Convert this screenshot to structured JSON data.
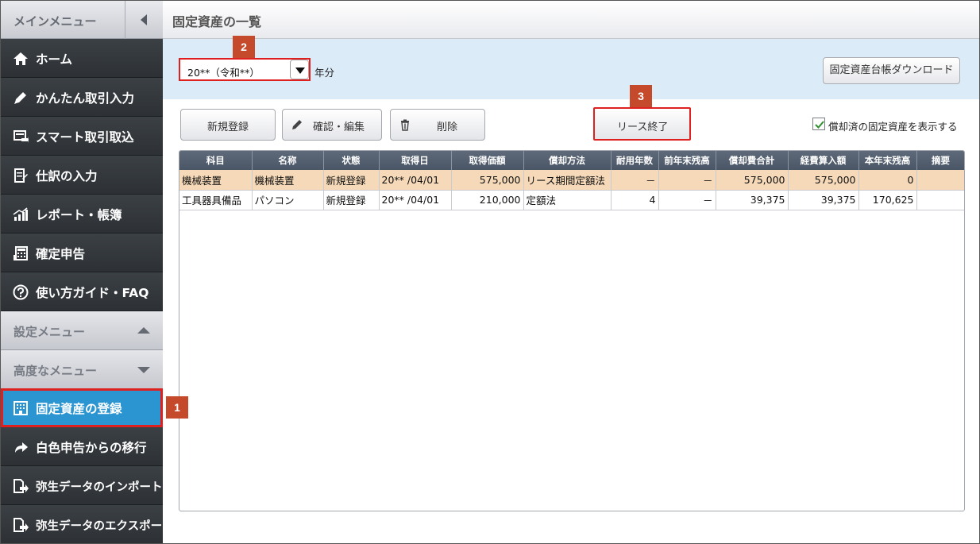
{
  "sidebar": {
    "main_menu_label": "メインメニュー",
    "items": [
      {
        "label": "ホーム",
        "icon": "home-icon"
      },
      {
        "label": "かんたん取引入力",
        "icon": "pencil-icon"
      },
      {
        "label": "スマート取引取込",
        "icon": "import-icon"
      },
      {
        "label": "仕訳の入力",
        "icon": "journal-icon"
      },
      {
        "label": "レポート・帳簿",
        "icon": "bar-chart-icon"
      },
      {
        "label": "確定申告",
        "icon": "calculator-icon"
      },
      {
        "label": "使い方ガイド・FAQ",
        "icon": "help-icon"
      }
    ],
    "settings_menu_label": "設定メニュー",
    "advanced_menu_label": "高度なメニュー",
    "advanced_items": [
      {
        "label": "固定資産の登録",
        "icon": "building-icon",
        "active": true
      },
      {
        "label": "白色申告からの移行",
        "icon": "arrow-forward-icon"
      },
      {
        "label": "弥生データのインポート",
        "icon": "import-file-icon"
      },
      {
        "label": "弥生データのエクスポート",
        "icon": "export-file-icon"
      }
    ]
  },
  "page": {
    "title": "固定資産の一覧"
  },
  "filter": {
    "year_value": "20**（令和**）",
    "year_suffix": "年分",
    "download_label": "固定資産台帳ダウンロード"
  },
  "toolbar": {
    "new_label": "新規登録",
    "edit_label": "確認・編集",
    "delete_label": "削除",
    "lease_end_label": "リース終了",
    "show_depreciated_label": "償却済の固定資産を表示する",
    "show_depreciated_checked": true
  },
  "badges": {
    "b1": "1",
    "b2": "2",
    "b3": "3"
  },
  "table": {
    "headers": [
      "科目",
      "名称",
      "状態",
      "取得日",
      "取得価額",
      "償却方法",
      "耐用年数",
      "前年末残高",
      "償却費合計",
      "経費算入額",
      "本年末残高",
      "摘要"
    ],
    "rows": [
      [
        "機械装置",
        "機械装置",
        "新規登録",
        "20** /04/01",
        "575,000",
        "リース期間定額法",
        "－",
        "－",
        "575,000",
        "575,000",
        "0",
        ""
      ],
      [
        "工具器具備品",
        "パソコン",
        "新規登録",
        "20** /04/01",
        "210,000",
        "定額法",
        "4",
        "－",
        "39,375",
        "39,375",
        "170,625",
        ""
      ]
    ]
  },
  "colors": {
    "sidebar_bg": "#2f3337",
    "active_item": "#2b95d2",
    "highlight_border": "#e01f1f",
    "badge": "#c44a2b",
    "filter_band": "#dcebf8",
    "selected_row": "#f5d9b8"
  }
}
